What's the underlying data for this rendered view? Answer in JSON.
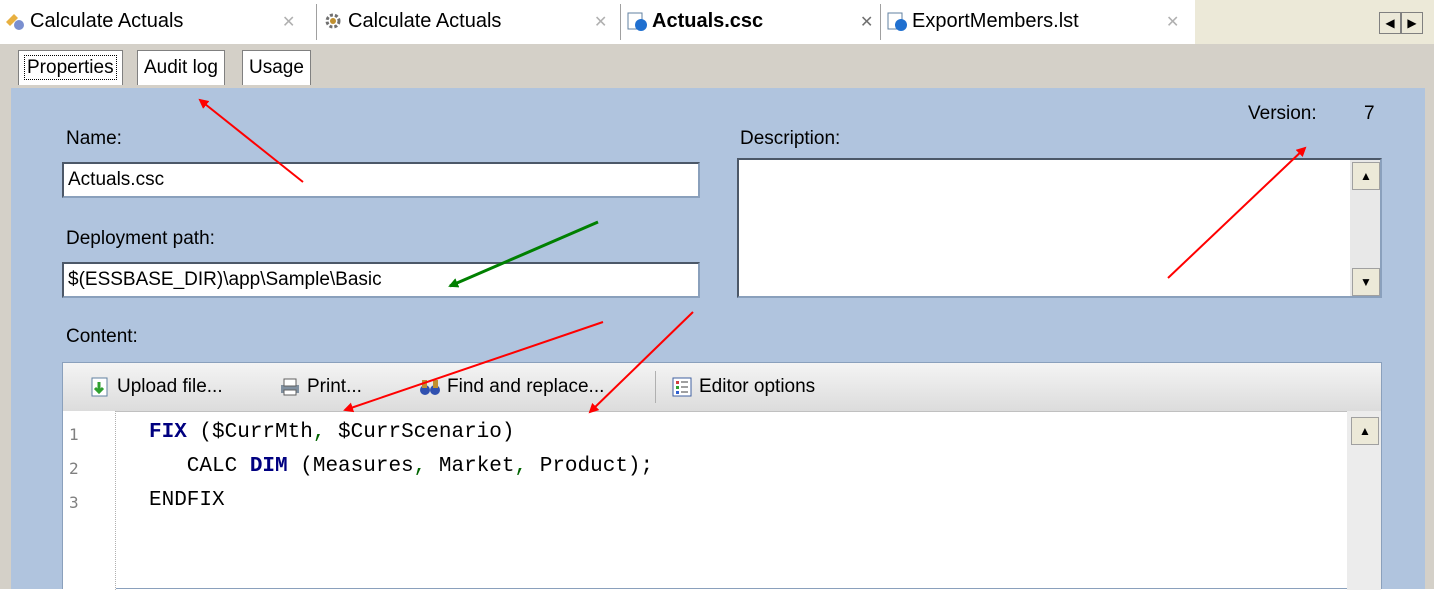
{
  "doc_tabs": [
    {
      "label": "Calculate Actuals",
      "icon": "rules-icon",
      "active": false
    },
    {
      "label": "Calculate Actuals",
      "icon": "gear-icon",
      "active": false
    },
    {
      "label": "Actuals.csc",
      "icon": "calc-script-icon",
      "active": true
    },
    {
      "label": "ExportMembers.lst",
      "icon": "file-icon",
      "active": false
    }
  ],
  "inner_tabs": [
    {
      "label": "Properties"
    },
    {
      "label": "Audit log"
    },
    {
      "label": "Usage"
    }
  ],
  "version": {
    "label": "Version:",
    "value": "7"
  },
  "name": {
    "label": "Name:",
    "value": "Actuals.csc"
  },
  "description": {
    "label": "Description:",
    "value": ""
  },
  "deployment": {
    "label": "Deployment path:",
    "value": "$(ESSBASE_DIR)\\app\\Sample\\Basic"
  },
  "content": {
    "label": "Content:"
  },
  "editor_toolbar": {
    "upload": "Upload file...",
    "print": "Print...",
    "find": "Find and replace...",
    "options": "Editor options"
  },
  "code_lines": [
    {
      "num": "1",
      "parts": [
        {
          "t": "FIX",
          "c": "kw"
        },
        {
          "t": " ($CurrMth",
          "c": "vr"
        },
        {
          "t": ",",
          "c": "pn"
        },
        {
          "t": " $CurrScenario)",
          "c": "vr"
        }
      ]
    },
    {
      "num": "2",
      "parts": [
        {
          "t": "   CALC ",
          "c": "vr"
        },
        {
          "t": "DIM",
          "c": "kw"
        },
        {
          "t": " (Measures",
          "c": "vr"
        },
        {
          "t": ",",
          "c": "pn"
        },
        {
          "t": " Market",
          "c": "vr"
        },
        {
          "t": ",",
          "c": "pn"
        },
        {
          "t": " Product);",
          "c": "vr"
        }
      ]
    },
    {
      "num": "3",
      "parts": [
        {
          "t": "ENDFIX",
          "c": "vr"
        }
      ]
    }
  ],
  "colors": {
    "panel_bg": "#b0c4de",
    "keyword": "#000080",
    "arrow_red": "#ff0000",
    "arrow_green": "#008000"
  }
}
